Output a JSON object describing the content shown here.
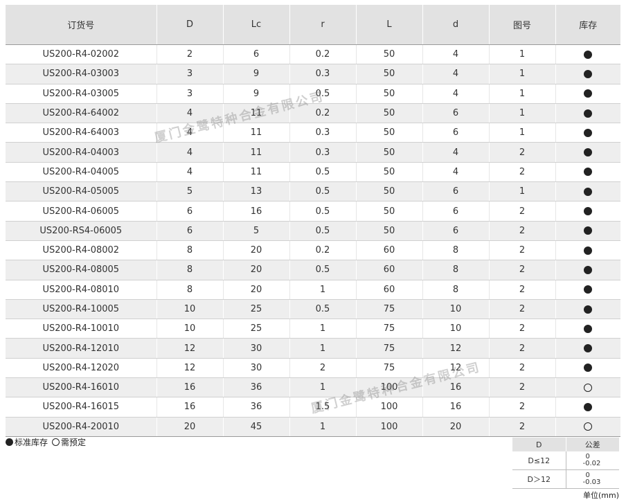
{
  "headers": [
    "订货号",
    "D",
    "Lc",
    "r",
    "L",
    "d",
    "图号",
    "库存"
  ],
  "rows": [
    [
      "US200-R4-02002",
      "2",
      "6",
      "0.2",
      "50",
      "4",
      "1",
      "filled"
    ],
    [
      "US200-R4-03003",
      "3",
      "9",
      "0.3",
      "50",
      "4",
      "1",
      "filled"
    ],
    [
      "US200-R4-03005",
      "3",
      "9",
      "0.5",
      "50",
      "4",
      "1",
      "filled"
    ],
    [
      "US200-R4-64002",
      "4",
      "11",
      "0.2",
      "50",
      "6",
      "1",
      "filled"
    ],
    [
      "US200-R4-64003",
      "4",
      "11",
      "0.3",
      "50",
      "6",
      "1",
      "filled"
    ],
    [
      "US200-R4-04003",
      "4",
      "11",
      "0.3",
      "50",
      "4",
      "2",
      "filled"
    ],
    [
      "US200-R4-04005",
      "4",
      "11",
      "0.5",
      "50",
      "4",
      "2",
      "filled"
    ],
    [
      "US200-R4-05005",
      "5",
      "13",
      "0.5",
      "50",
      "6",
      "1",
      "filled"
    ],
    [
      "US200-R4-06005",
      "6",
      "16",
      "0.5",
      "50",
      "6",
      "2",
      "filled"
    ],
    [
      "US200-RS4-06005",
      "6",
      "5",
      "0.5",
      "50",
      "6",
      "2",
      "filled"
    ],
    [
      "US200-R4-08002",
      "8",
      "20",
      "0.2",
      "60",
      "8",
      "2",
      "filled"
    ],
    [
      "US200-R4-08005",
      "8",
      "20",
      "0.5",
      "60",
      "8",
      "2",
      "filled"
    ],
    [
      "US200-R4-08010",
      "8",
      "20",
      "1",
      "60",
      "8",
      "2",
      "filled"
    ],
    [
      "US200-R4-10005",
      "10",
      "25",
      "0.5",
      "75",
      "10",
      "2",
      "filled"
    ],
    [
      "US200-R4-10010",
      "10",
      "25",
      "1",
      "75",
      "10",
      "2",
      "filled"
    ],
    [
      "US200-R4-12010",
      "12",
      "30",
      "1",
      "75",
      "12",
      "2",
      "filled"
    ],
    [
      "US200-R4-12020",
      "12",
      "30",
      "2",
      "75",
      "12",
      "2",
      "filled"
    ],
    [
      "US200-R4-16010",
      "16",
      "36",
      "1",
      "100",
      "16",
      "2",
      "empty"
    ],
    [
      "US200-R4-16015",
      "16",
      "36",
      "1.5",
      "100",
      "16",
      "2",
      "filled"
    ],
    [
      "US200-R4-20010",
      "20",
      "45",
      "1",
      "100",
      "20",
      "2",
      "empty"
    ]
  ],
  "watermark": "厦门金鹭特种合金有限公司",
  "legend": {
    "standard": "标准库存",
    "order": "需预定"
  },
  "tolerance": {
    "headers": [
      "D",
      "公差"
    ],
    "rows": [
      {
        "range": "D≤12",
        "upper": "0",
        "lower": "-0.02"
      },
      {
        "range": "D＞12",
        "upper": "0",
        "lower": "-0.03"
      }
    ]
  },
  "unit": "单位(mm)"
}
